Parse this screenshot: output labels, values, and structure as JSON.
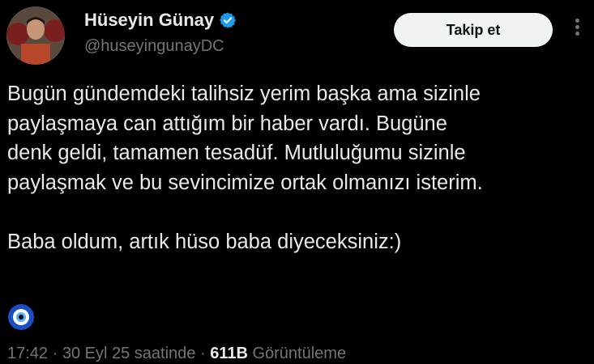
{
  "author": {
    "name": "Hüseyin Günay",
    "handle": "@huseyingunayDC",
    "verified": true
  },
  "actions": {
    "follow_label": "Takip et"
  },
  "tweet": {
    "lines": [
      "Bugün gündemdeki talihsiz yerim başka ama sizinle",
      "paylaşmaya can attığım bir haber vardı. Bugüne",
      "denk geldi, tamamen tesadüf. Mutluluğumu sizinle",
      "paylaşmak ve bu sevincimize ortak olmanızı isterim."
    ],
    "second_paragraph": "Baba oldum, artık hüso baba diyeceksiniz:)",
    "emoji": "nazar-amulet-icon"
  },
  "meta": {
    "time": "17:42",
    "sep1": " · ",
    "date": "30 Eyl 25 saatinde",
    "sep2": " · ",
    "views": "611B",
    "views_label": "Görüntüleme"
  },
  "colors": {
    "background": "#000000",
    "text": "#e7e9ea",
    "muted": "#71767b",
    "verified_badge": "#1d9bf0",
    "button_bg": "#eff3f4"
  }
}
